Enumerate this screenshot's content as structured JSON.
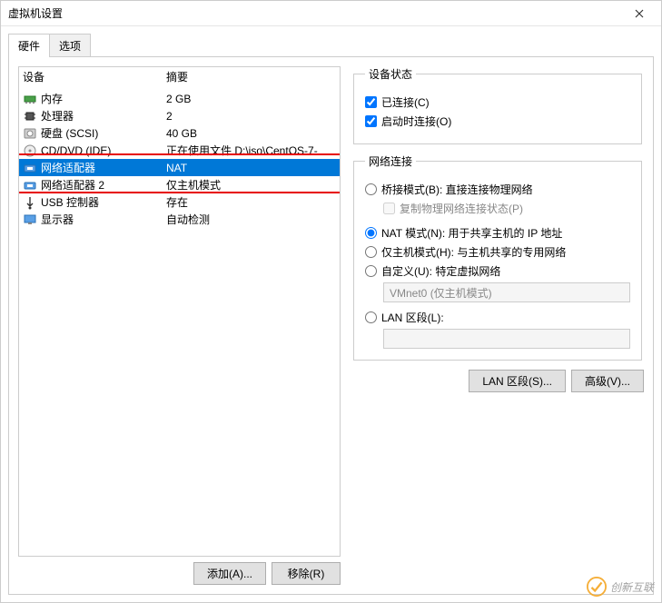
{
  "window": {
    "title": "虚拟机设置"
  },
  "tabs": {
    "hardware": "硬件",
    "options": "选项"
  },
  "headers": {
    "device": "设备",
    "summary": "摘要"
  },
  "devices": [
    {
      "icon": "memory",
      "name": "内存",
      "summary": "2 GB",
      "sel": false
    },
    {
      "icon": "cpu",
      "name": "处理器",
      "summary": "2",
      "sel": false
    },
    {
      "icon": "disk",
      "name": "硬盘 (SCSI)",
      "summary": "40 GB",
      "sel": false
    },
    {
      "icon": "cd",
      "name": "CD/DVD (IDE)",
      "summary": "正在使用文件 D:\\iso\\CentOS-7-",
      "sel": false
    },
    {
      "icon": "net",
      "name": "网络适配器",
      "summary": "NAT",
      "sel": true
    },
    {
      "icon": "net",
      "name": "网络适配器 2",
      "summary": "仅主机模式",
      "sel": false
    },
    {
      "icon": "usb",
      "name": "USB 控制器",
      "summary": "存在",
      "sel": false
    },
    {
      "icon": "display",
      "name": "显示器",
      "summary": "自动检测",
      "sel": false
    }
  ],
  "left_buttons": {
    "add": "添加(A)...",
    "remove": "移除(R)"
  },
  "status": {
    "legend": "设备状态",
    "connected": "已连接(C)",
    "connect_at_power_on": "启动时连接(O)"
  },
  "net": {
    "legend": "网络连接",
    "bridged": "桥接模式(B): 直接连接物理网络",
    "replicate": "复制物理网络连接状态(P)",
    "nat": "NAT 模式(N): 用于共享主机的 IP 地址",
    "hostonly": "仅主机模式(H): 与主机共享的专用网络",
    "custom": "自定义(U): 特定虚拟网络",
    "custom_val": "VMnet0 (仅主机模式)",
    "lan_seg": "LAN 区段(L):",
    "lan_seg_btn": "LAN 区段(S)...",
    "advanced_btn": "高级(V)..."
  },
  "watermark": "创新互联"
}
